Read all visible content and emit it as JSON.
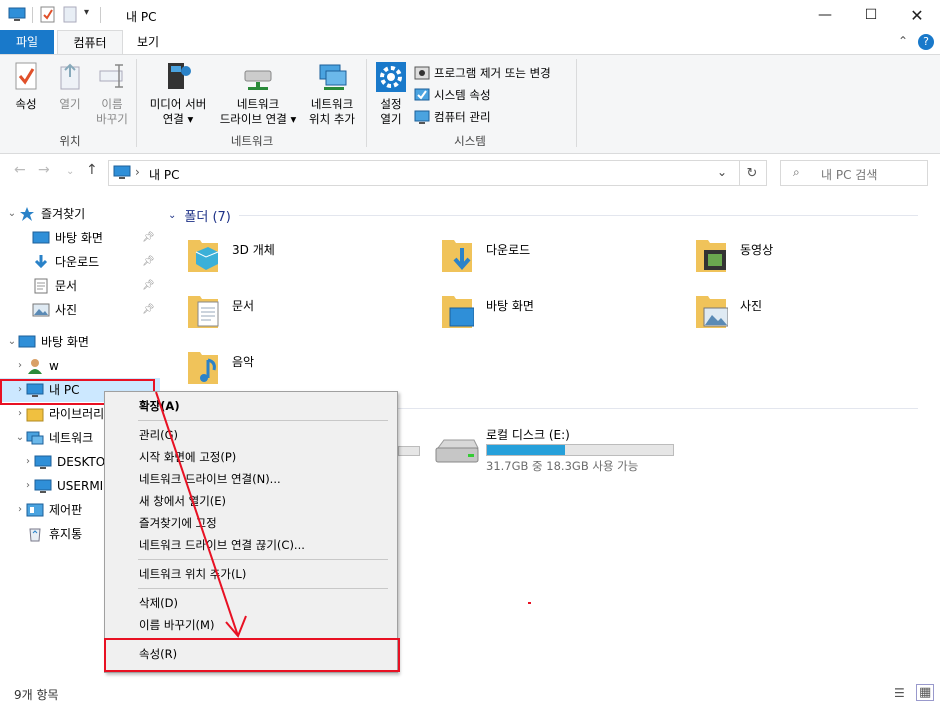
{
  "window": {
    "title": "내 PC"
  },
  "tabs": [
    {
      "label": "파일"
    },
    {
      "label": "컴퓨터"
    },
    {
      "label": "보기"
    }
  ],
  "ribbon": {
    "location": {
      "group": "위치",
      "properties": "속성",
      "open": "열기",
      "rename": "이름\n바꾸기"
    },
    "network": {
      "group": "네트워크",
      "media_server": "미디어 서버\n연결 ▾",
      "map_drive": "네트워크\n드라이브 연결 ▾",
      "add_location": "네트워크\n위치 추가"
    },
    "system": {
      "group": "시스템",
      "open_settings": "설정\n열기",
      "uninstall": "프로그램 제거 또는 변경",
      "sys_props": "시스템 속성",
      "manage": "컴퓨터 관리"
    }
  },
  "address": {
    "path": "내 PC",
    "search_placeholder": "내 PC 검색"
  },
  "nav": {
    "quick_access": "즐겨찾기",
    "qa_items": [
      {
        "label": "바탕 화면"
      },
      {
        "label": "다운로드"
      },
      {
        "label": "문서"
      },
      {
        "label": "사진"
      }
    ],
    "desktop": "바탕 화면",
    "items": [
      {
        "label": "w"
      },
      {
        "label": "내 PC"
      },
      {
        "label": "라이브러리"
      },
      {
        "label": "네트워크"
      },
      {
        "label": "DESKTOP"
      },
      {
        "label": "USERMI"
      },
      {
        "label": "제어판"
      },
      {
        "label": "휴지통"
      }
    ]
  },
  "content": {
    "folders_header": "폴더 (7)",
    "folders": [
      {
        "label": "3D 개체"
      },
      {
        "label": "다운로드"
      },
      {
        "label": "동영상"
      },
      {
        "label": "문서"
      },
      {
        "label": "바탕 화면"
      },
      {
        "label": "사진"
      },
      {
        "label": "음악"
      }
    ],
    "drive": {
      "label": "로컬 디스크 (E:)",
      "space": "31.7GB 중 18.3GB 사용 가능",
      "used_fraction": 0.42
    }
  },
  "context_menu": {
    "items": [
      {
        "label": "확장(A)"
      },
      {
        "label": "관리(G)"
      },
      {
        "label": "시작 화면에 고정(P)"
      },
      {
        "label": "네트워크 드라이브 연결(N)..."
      },
      {
        "label": "새 창에서 열기(E)"
      },
      {
        "label": "즐겨찾기에 고정"
      },
      {
        "label": "네트워크 드라이브 연결 끊기(C)..."
      },
      {
        "label": "네트워크 위치 추가(L)"
      },
      {
        "label": "삭제(D)"
      },
      {
        "label": "이름 바꾸기(M)"
      },
      {
        "label": "속성(R)"
      }
    ]
  },
  "status": {
    "count": "9개 항목"
  },
  "colors": {
    "accent": "#1979ca",
    "highlight": "#e81123",
    "selection": "#cce8ff"
  }
}
